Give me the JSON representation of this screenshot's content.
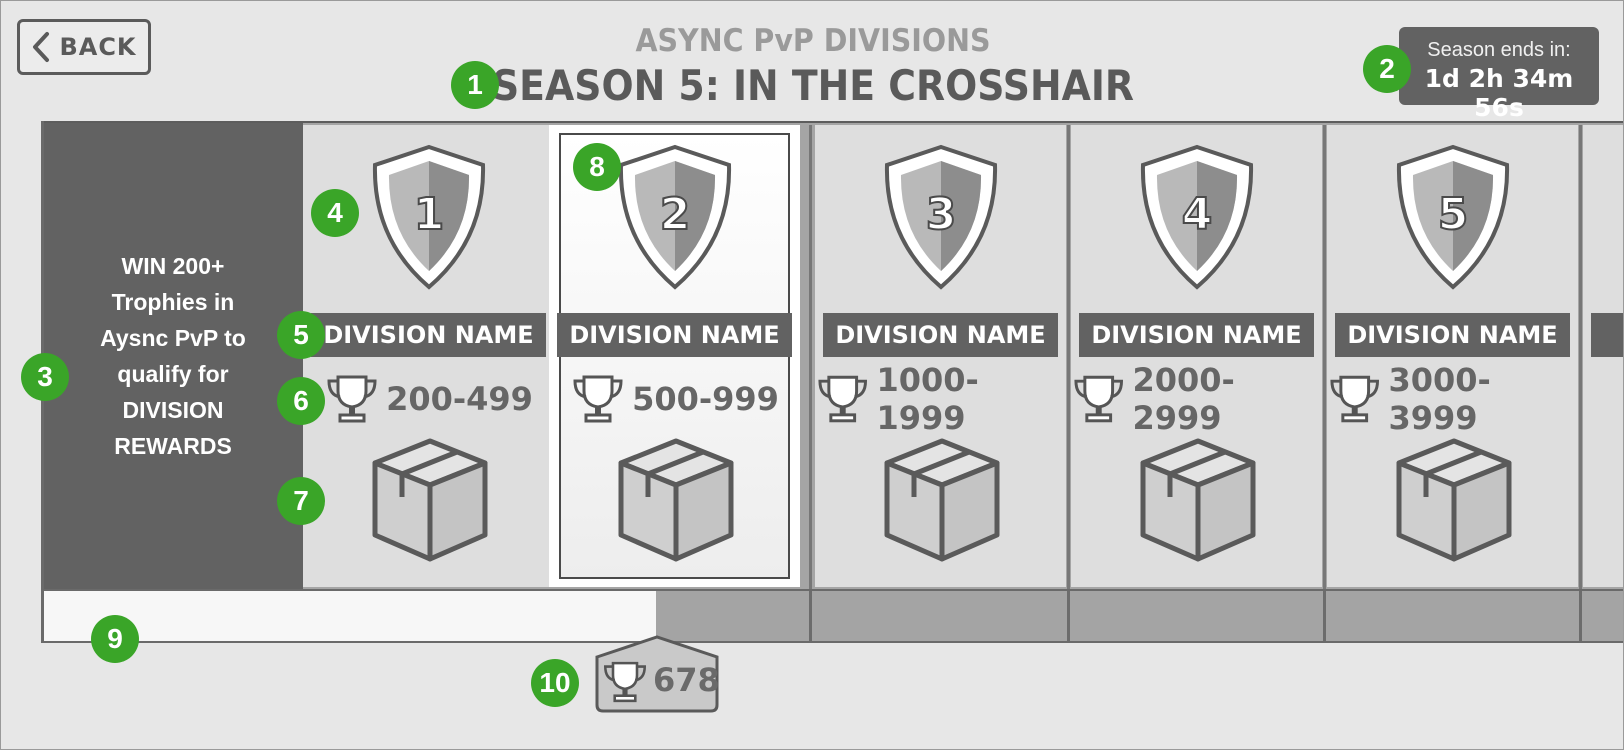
{
  "header": {
    "back_label": "BACK",
    "subtitle": "ASYNC PvP DIVISIONS",
    "title": "SEASON 5: IN THE CROSSHAIR"
  },
  "season": {
    "label": "Season ends in:",
    "time": "1d 2h 34m 56s"
  },
  "info_panel": {
    "text": "WIN 200+\nTrophies in\nAysnc PvP to\nqualify for\nDIVISION\nREWARDS"
  },
  "divisions": [
    {
      "number": "1",
      "name": "DIVISION NAME",
      "range": "200-499",
      "selected": false
    },
    {
      "number": "2",
      "name": "DIVISION NAME",
      "range": "500-999",
      "selected": true
    },
    {
      "number": "3",
      "name": "DIVISION NAME",
      "range": "1000-1999",
      "selected": false
    },
    {
      "number": "4",
      "name": "DIVISION NAME",
      "range": "2000-2999",
      "selected": false
    },
    {
      "number": "5",
      "name": "DIVISION NAME",
      "range": "3000-3999",
      "selected": false
    }
  ],
  "progress": {
    "trophies": "678"
  },
  "annotation_badges": [
    "1",
    "2",
    "3",
    "4",
    "5",
    "6",
    "7",
    "8",
    "9",
    "10"
  ],
  "colors": {
    "badge_green": "#3aa528",
    "dark_panel": "#626262",
    "card_bg": "#dedede"
  }
}
